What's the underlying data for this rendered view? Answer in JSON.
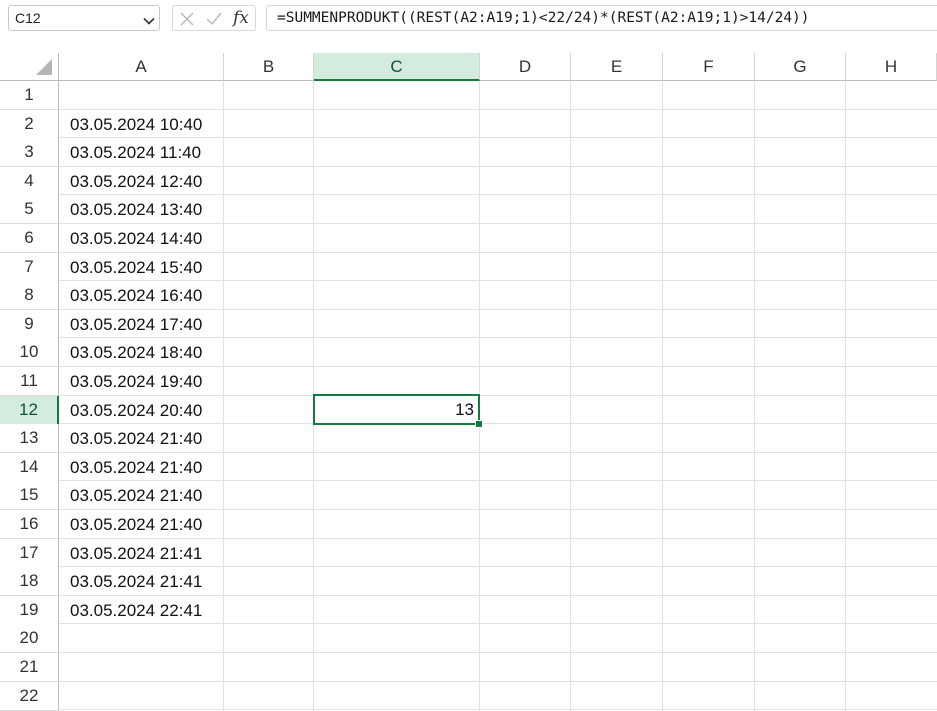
{
  "formula_bar": {
    "name_box": "C12",
    "fx_label": "fx",
    "formula": "=SUMMENPRODUKT((REST(A2:A19;1)<22/24)*(REST(A2:A19;1)>14/24))"
  },
  "columns": [
    "A",
    "B",
    "C",
    "D",
    "E",
    "F",
    "G",
    "H"
  ],
  "selected_column": "C",
  "rows": [
    "1",
    "2",
    "3",
    "4",
    "5",
    "6",
    "7",
    "8",
    "9",
    "10",
    "11",
    "12",
    "13",
    "14",
    "15",
    "16",
    "17",
    "18",
    "19",
    "20",
    "21",
    "22"
  ],
  "selected_row": "12",
  "column_a_values": [
    "",
    "03.05.2024 10:40",
    "03.05.2024 11:40",
    "03.05.2024 12:40",
    "03.05.2024 13:40",
    "03.05.2024 14:40",
    "03.05.2024 15:40",
    "03.05.2024 16:40",
    "03.05.2024 17:40",
    "03.05.2024 18:40",
    "03.05.2024 19:40",
    "03.05.2024 20:40",
    "03.05.2024 21:40",
    "03.05.2024 21:40",
    "03.05.2024 21:40",
    "03.05.2024 21:40",
    "03.05.2024 21:41",
    "03.05.2024 21:41",
    "03.05.2024 22:41",
    "",
    "",
    ""
  ],
  "cell_c12": "13",
  "colors": {
    "accent": "#107c41",
    "header_selected": "#d3ecdd",
    "gridline": "#e1e1e1"
  },
  "icons": [
    "chevron-down-icon",
    "cancel-icon",
    "enter-icon",
    "select-all-icon"
  ]
}
